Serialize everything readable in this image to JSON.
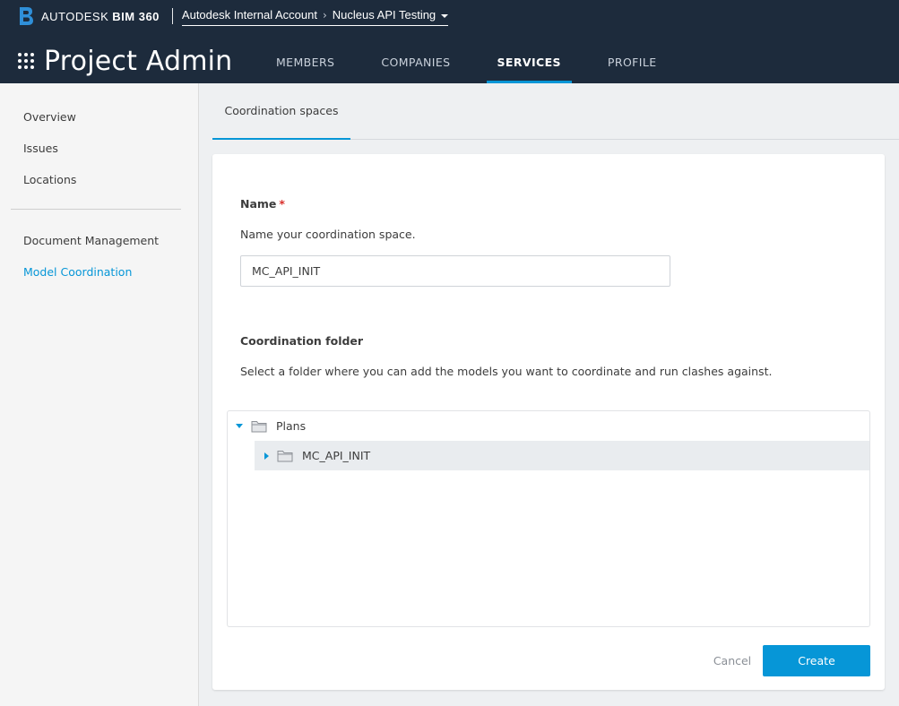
{
  "header": {
    "brand": "AUTODESK",
    "product": "BIM 360",
    "breadcrumb": {
      "account": "Autodesk Internal Account",
      "project": "Nucleus API Testing"
    },
    "app_title": "Project Admin",
    "tabs": [
      {
        "label": "MEMBERS",
        "active": false
      },
      {
        "label": "COMPANIES",
        "active": false
      },
      {
        "label": "SERVICES",
        "active": true
      },
      {
        "label": "PROFILE",
        "active": false
      }
    ]
  },
  "sidebar": {
    "items": [
      {
        "label": "Overview",
        "active": false
      },
      {
        "label": "Issues",
        "active": false
      },
      {
        "label": "Locations",
        "active": false
      },
      {
        "label": "Document Management",
        "active": false
      },
      {
        "label": "Model Coordination",
        "active": true
      }
    ]
  },
  "content": {
    "subtab": "Coordination spaces",
    "form": {
      "name_label": "Name",
      "required_mark": "*",
      "name_help": "Name your coordination space.",
      "name_value": "MC_API_INIT",
      "folder_label": "Coordination folder",
      "folder_help": "Select a folder where you can add the models you want to coordinate and run clashes against.",
      "tree": [
        {
          "label": "Plans",
          "expanded": true
        },
        {
          "label": "MC_API_INIT",
          "expanded": false,
          "selected": true
        }
      ],
      "cancel_label": "Cancel",
      "create_label": "Create"
    }
  },
  "colors": {
    "header_bg": "#1d2b3c",
    "accent": "#0696d7",
    "required": "#d9302c"
  }
}
